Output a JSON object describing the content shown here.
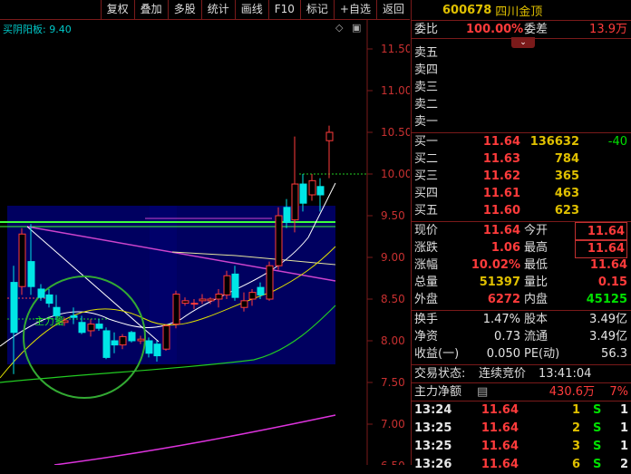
{
  "toolbar": {
    "items": [
      "复权",
      "叠加",
      "多股",
      "统计",
      "画线",
      "F10",
      "标记",
      "+自选",
      "返回"
    ]
  },
  "chart": {
    "indicator_label": "买阴阳板",
    "indicator_value": "9.40",
    "price_labels": [
      "11.50",
      "11.00",
      "10.50",
      "10.00",
      "9.50",
      "9.00",
      "8.50",
      "8.00",
      "7.50",
      "7.00",
      "6.50"
    ],
    "annotation": "主力蓄"
  },
  "quote": {
    "code": "600678",
    "name": "四川金顶",
    "weibi_label": "委比",
    "weibi_value": "100.00%",
    "weicha_label": "委差",
    "weicha_value": "13.9万",
    "asks": [
      {
        "label": "卖五"
      },
      {
        "label": "卖四"
      },
      {
        "label": "卖三"
      },
      {
        "label": "卖二"
      },
      {
        "label": "卖一"
      }
    ],
    "bids": [
      {
        "label": "买一",
        "price": "11.64",
        "vol": "136632",
        "chg": "-40"
      },
      {
        "label": "买二",
        "price": "11.63",
        "vol": "784",
        "chg": ""
      },
      {
        "label": "买三",
        "price": "11.62",
        "vol": "365",
        "chg": ""
      },
      {
        "label": "买四",
        "price": "11.61",
        "vol": "463",
        "chg": ""
      },
      {
        "label": "买五",
        "price": "11.60",
        "vol": "623",
        "chg": ""
      }
    ],
    "stats": [
      {
        "l1": "现价",
        "v1": "11.64",
        "l2": "今开",
        "v2": "11.64"
      },
      {
        "l1": "涨跌",
        "v1": "1.06",
        "l2": "最高",
        "v2": "11.64"
      },
      {
        "l1": "涨幅",
        "v1": "10.02%",
        "l2": "最低",
        "v2": "11.64"
      },
      {
        "l1": "总量",
        "v1": "51397",
        "l2": "量比",
        "v2": "0.15"
      },
      {
        "l1": "外盘",
        "v1": "6272",
        "l2": "内盘",
        "v2": "45125"
      }
    ],
    "stats2": [
      {
        "l1": "换手",
        "v1": "1.47%",
        "l2": "股本",
        "v2": "3.49亿"
      },
      {
        "l1": "净资",
        "v1": "0.73",
        "l2": "流通",
        "v2": "3.49亿"
      },
      {
        "l1": "收益(一)",
        "v1": "0.050",
        "l2": "PE(动)",
        "v2": "56.3"
      }
    ],
    "status_label": "交易状态:",
    "status_value": "连续竞价",
    "status_time": "13:41:04",
    "netflow_label": "主力净额",
    "netflow_value": "430.6万",
    "netflow_pct": "7%",
    "trades": [
      {
        "time": "13:24",
        "price": "11.64",
        "vol": "1",
        "side": "S",
        "n": "1"
      },
      {
        "time": "13:25",
        "price": "11.64",
        "vol": "2",
        "side": "S",
        "n": "1"
      },
      {
        "time": "13:25",
        "price": "11.64",
        "vol": "3",
        "side": "S",
        "n": "1"
      },
      {
        "time": "13:26",
        "price": "11.64",
        "vol": "6",
        "side": "S",
        "n": "2"
      }
    ]
  },
  "colors": {
    "up": "#ff3b3b",
    "down": "#00e6e6",
    "bg": "#000000",
    "box": "#000060"
  }
}
